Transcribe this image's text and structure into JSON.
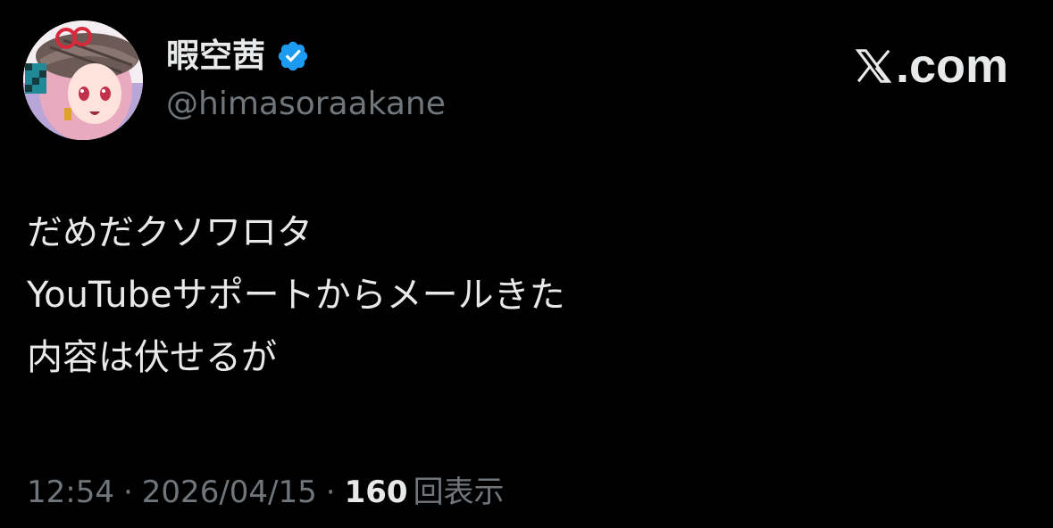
{
  "post": {
    "author": {
      "display_name": "暇空茜",
      "handle": "@himasoraakane",
      "verified": true,
      "avatar_icon": "anime-avatar-icon"
    },
    "brand": {
      "text": ".com",
      "logo_icon": "x-logo-icon"
    },
    "text_lines": [
      "だめだクソワロタ",
      "YouTubeサポートからメールきた",
      "内容は伏せるが"
    ],
    "meta": {
      "time": "12:54",
      "separator": "·",
      "date": "2026/04/15",
      "views_count": "160",
      "views_label": "回表示"
    }
  },
  "colors": {
    "background": "#000000",
    "primary_text": "#e7e9ea",
    "secondary_text": "#71767b",
    "verified_badge": "#1d9bf0"
  }
}
